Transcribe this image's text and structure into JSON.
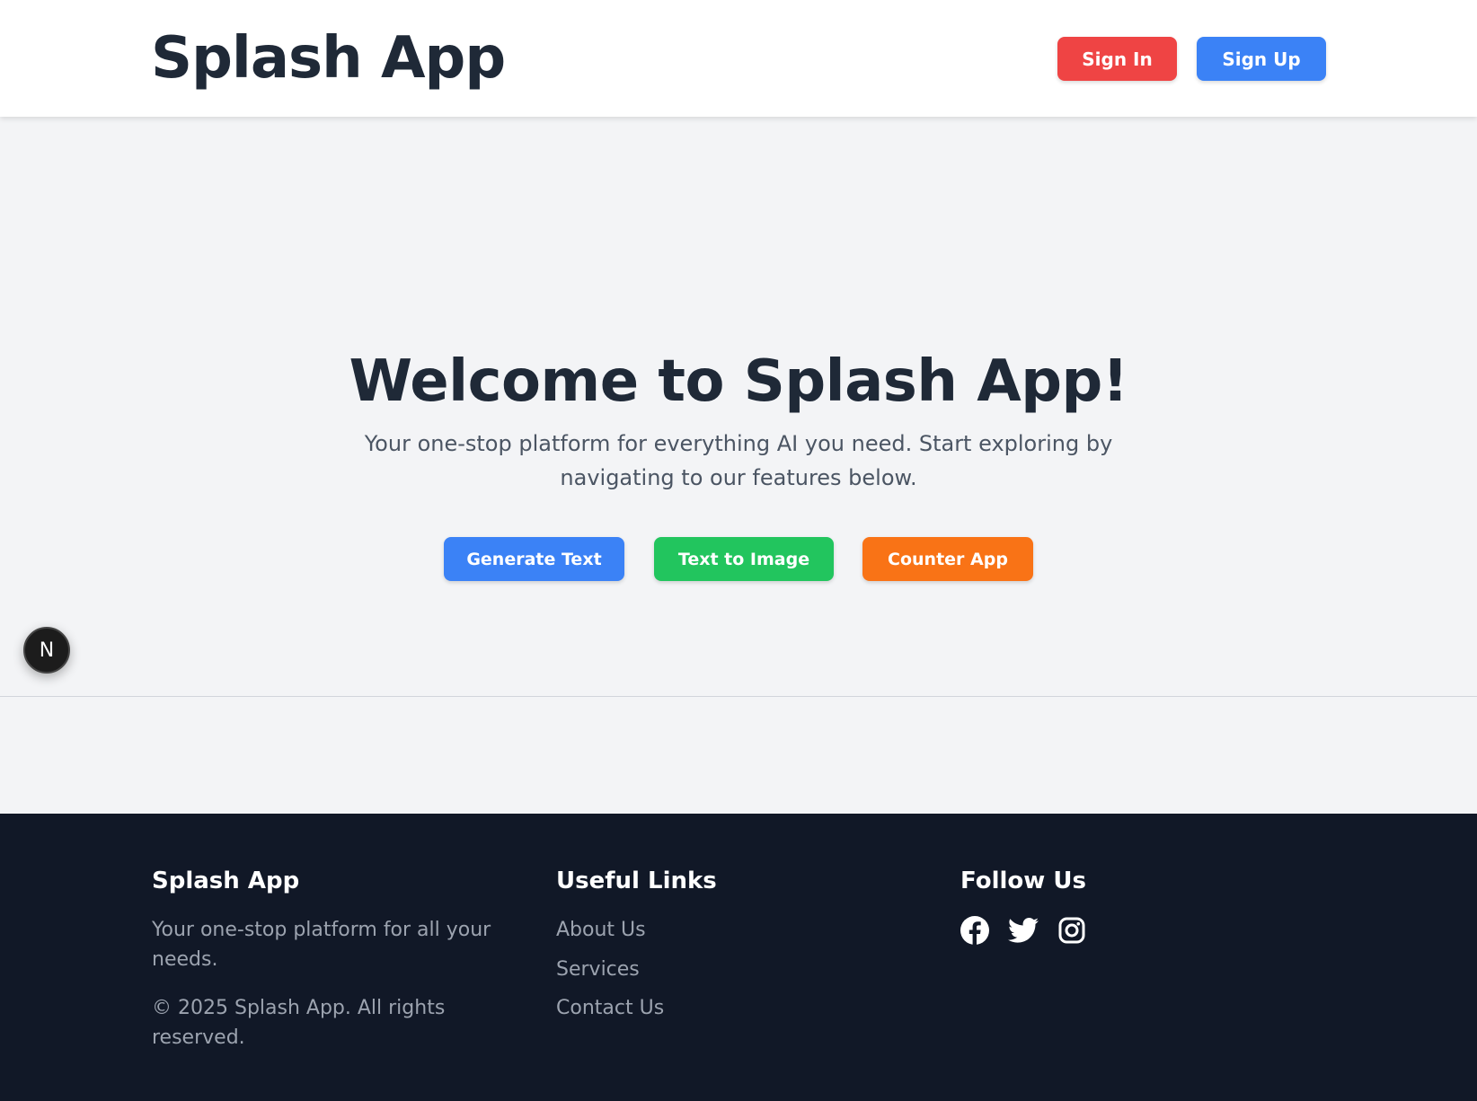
{
  "header": {
    "logo": "Splash App",
    "sign_in_label": "Sign In",
    "sign_up_label": "Sign Up"
  },
  "hero": {
    "title": "Welcome to Splash App!",
    "subtitle": "Your one-stop platform for everything AI you need. Start exploring by navigating to our features below.",
    "buttons": [
      {
        "label": "Generate Text",
        "color": "#3b82f6"
      },
      {
        "label": "Text to Image",
        "color": "#22c55e"
      },
      {
        "label": "Counter App",
        "color": "#f97316"
      }
    ]
  },
  "dev_badge": {
    "label": "N"
  },
  "footer": {
    "brand": {
      "title": "Splash App",
      "tagline": "Your one-stop platform for all your needs.",
      "copyright": "© 2025 Splash App. All rights reserved."
    },
    "links": {
      "title": "Useful Links",
      "items": [
        "About Us",
        "Services",
        "Contact Us"
      ]
    },
    "follow": {
      "title": "Follow Us",
      "icons": [
        "facebook-icon",
        "twitter-icon",
        "instagram-icon"
      ]
    }
  },
  "colors": {
    "sign_in": "#ef4444",
    "sign_up": "#3b82f6",
    "footer_bg": "#111827",
    "page_bg": "#f3f4f6"
  }
}
